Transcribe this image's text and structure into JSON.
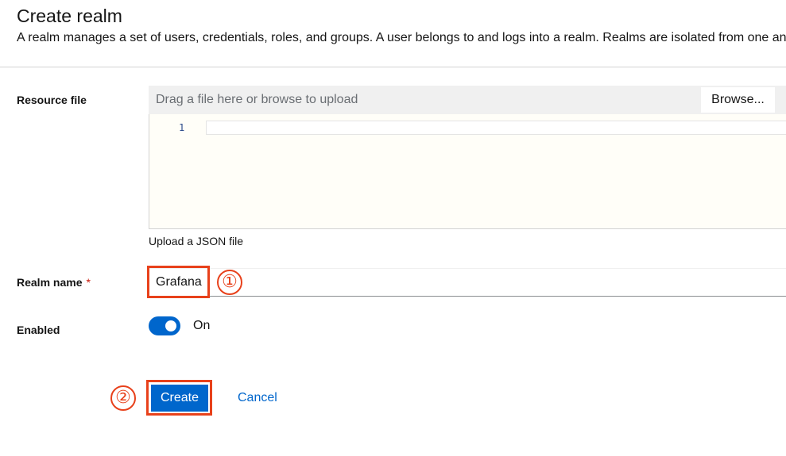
{
  "header": {
    "title": "Create realm",
    "description": "A realm manages a set of users, credentials, roles, and groups. A user belongs to and logs into a realm. Realms are isolated from one another"
  },
  "resource_file": {
    "label": "Resource file",
    "placeholder": "Drag a file here or browse to upload",
    "browse_label": "Browse...",
    "line_number": "1",
    "helper_text": "Upload a JSON file"
  },
  "realm_name": {
    "label": "Realm name",
    "required_marker": "*",
    "value": "Grafana"
  },
  "enabled": {
    "label": "Enabled",
    "state_label": "On",
    "checked": true
  },
  "actions": {
    "create_label": "Create",
    "cancel_label": "Cancel"
  },
  "annotations": {
    "step1": "①",
    "step2": "②",
    "color": "#e8411b"
  },
  "colors": {
    "primary": "#0066cc",
    "required": "#c9190b"
  }
}
